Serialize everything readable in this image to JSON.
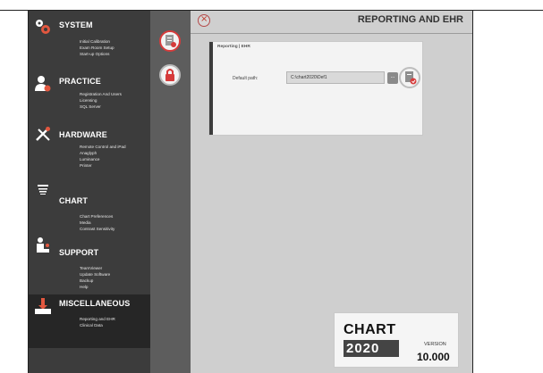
{
  "sidebar": {
    "sections": [
      {
        "title": "SYSTEM",
        "icon": "gears-icon",
        "items": [
          "Initial Calibration",
          "Exam Room Setup",
          "Start-up Options"
        ]
      },
      {
        "title": "PRACTICE",
        "icon": "user-gear-icon",
        "items": [
          "Registration And Users",
          "Licensing",
          "SQL Server"
        ]
      },
      {
        "title": "HARDWARE",
        "icon": "tools-icon",
        "items": [
          "Remote Control and iPad",
          "Anaglyph",
          "Luminance",
          "Printer"
        ]
      },
      {
        "title": "CHART",
        "icon": "eye-chart-icon",
        "items": [
          "Chart Preferences",
          "Media",
          "Contrast Sensitivity"
        ]
      },
      {
        "title": "SUPPORT",
        "icon": "support-person-icon",
        "items": [
          "TeamViewer",
          "Update Software",
          "Backup",
          "Help"
        ]
      },
      {
        "title": "MISCELLANEOUS",
        "icon": "download-tray-icon",
        "items": [
          "Reporting and EHR",
          "Clinical Data"
        ]
      }
    ]
  },
  "icon_column": {
    "buttons": [
      {
        "name": "report-document-icon"
      },
      {
        "name": "lock-icon"
      }
    ]
  },
  "main": {
    "title": "REPORTING AND EHR",
    "close_icon": "close-icon",
    "panel": {
      "title": "Reporting | EHR",
      "default_path_label": "Default path:",
      "default_path_value": "C:\\chart2020\\Def1",
      "browse_label": "..."
    }
  },
  "logo": {
    "chart_text": "CHART",
    "year_text": "2020",
    "version_label": "VERSION",
    "version_value": "10.000"
  },
  "colors": {
    "sidebar_bg": "#3c3c3c",
    "icon_column_bg": "#5d5d5d",
    "main_bg": "#cfcfcf",
    "accent_red": "#d63b3b"
  }
}
